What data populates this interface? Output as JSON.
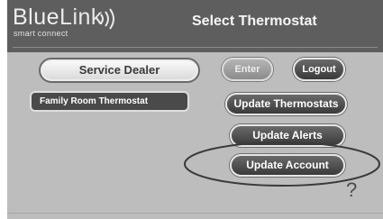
{
  "header": {
    "logo_blue": "Blue",
    "logo_link": "Link",
    "logo_tagline": "smart connect",
    "title": "Select Thermostat"
  },
  "buttons": {
    "service_dealer": "Service Dealer",
    "enter": "Enter",
    "logout": "Logout",
    "update_thermostats": "Update Thermostats",
    "update_alerts": "Update Alerts",
    "update_account": "Update Account"
  },
  "thermostats": [
    {
      "label": "Family Room Thermostat"
    }
  ],
  "help": {
    "symbol": "?"
  },
  "colors": {
    "header": "#5e5e5e",
    "background": "#bdbdbd",
    "dark_button": "#4a4a4a"
  }
}
